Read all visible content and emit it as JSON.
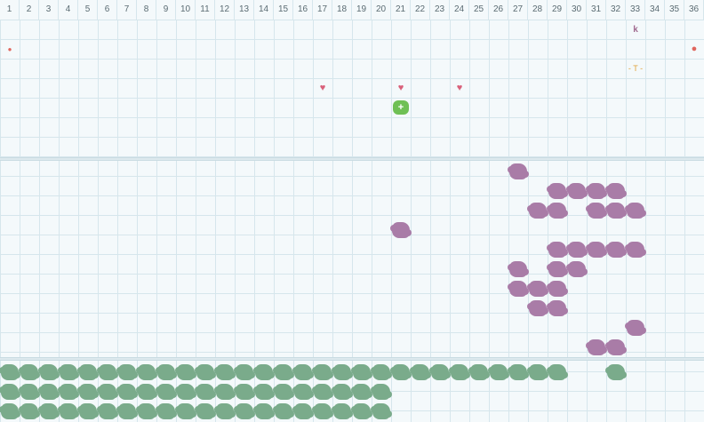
{
  "columns": [
    "1",
    "2",
    "3",
    "4",
    "5",
    "6",
    "7",
    "8",
    "9",
    "10",
    "11",
    "12",
    "13",
    "14",
    "15",
    "16",
    "17",
    "18",
    "19",
    "20",
    "21",
    "22",
    "23",
    "24",
    "25",
    "26",
    "27",
    "28",
    "29",
    "30",
    "31",
    "32",
    "33",
    "34",
    "35",
    "36"
  ],
  "colors": {
    "enemy": "#a97ca7",
    "ally": "#7aab8b",
    "player": "#6fc055",
    "heart": "#d9607a",
    "drop": "#e0665e",
    "key": "#a06a8f",
    "trap": "#e0a33c"
  },
  "player": {
    "symbol": "+",
    "col": 21,
    "row": 5,
    "icon": "player-icon"
  },
  "items": [
    {
      "icon": "blood-drop-icon",
      "symbol": "●",
      "col": 1,
      "row": 2
    },
    {
      "icon": "orb-icon",
      "symbol": "●",
      "col": 36,
      "row": 2
    },
    {
      "icon": "key-icon",
      "symbol": "k",
      "col": 33,
      "row": 1
    },
    {
      "icon": "trap-icon",
      "symbol": "- T -",
      "col": 33,
      "row": 3
    },
    {
      "icon": "heart-icon",
      "symbol": "♥",
      "col": 17,
      "row": 4
    },
    {
      "icon": "heart-icon",
      "symbol": "♥",
      "col": 21,
      "row": 4
    },
    {
      "icon": "heart-icon",
      "symbol": "♥",
      "col": 24,
      "row": 4
    }
  ],
  "enemies": [
    [
      27,
      8
    ],
    [
      29,
      9
    ],
    [
      30,
      9
    ],
    [
      31,
      9
    ],
    [
      32,
      9
    ],
    [
      28,
      10
    ],
    [
      29,
      10
    ],
    [
      31,
      10
    ],
    [
      32,
      10
    ],
    [
      33,
      10
    ],
    [
      21,
      11
    ],
    [
      29,
      12
    ],
    [
      30,
      12
    ],
    [
      31,
      12
    ],
    [
      32,
      12
    ],
    [
      33,
      12
    ],
    [
      27,
      13
    ],
    [
      29,
      13
    ],
    [
      30,
      13
    ],
    [
      27,
      14
    ],
    [
      28,
      14
    ],
    [
      29,
      14
    ],
    [
      28,
      15
    ],
    [
      29,
      15
    ],
    [
      33,
      16
    ],
    [
      31,
      17
    ],
    [
      32,
      17
    ]
  ],
  "allies_rows": [
    {
      "row": 18,
      "cols": [
        1,
        2,
        3,
        4,
        5,
        6,
        7,
        8,
        9,
        10,
        11,
        12,
        13,
        14,
        15,
        16,
        17,
        18,
        19,
        20,
        21,
        22,
        23,
        24,
        25,
        26,
        27,
        28,
        29,
        32
      ]
    },
    {
      "row": 19,
      "cols": [
        1,
        2,
        3,
        4,
        5,
        6,
        7,
        8,
        9,
        10,
        11,
        12,
        13,
        14,
        15,
        16,
        17,
        18,
        19,
        20
      ]
    },
    {
      "row": 20,
      "cols": [
        1,
        2,
        3,
        4,
        5,
        6,
        7,
        8,
        9,
        10,
        11,
        12,
        13,
        14,
        15,
        16,
        17,
        18,
        19,
        20
      ]
    }
  ]
}
